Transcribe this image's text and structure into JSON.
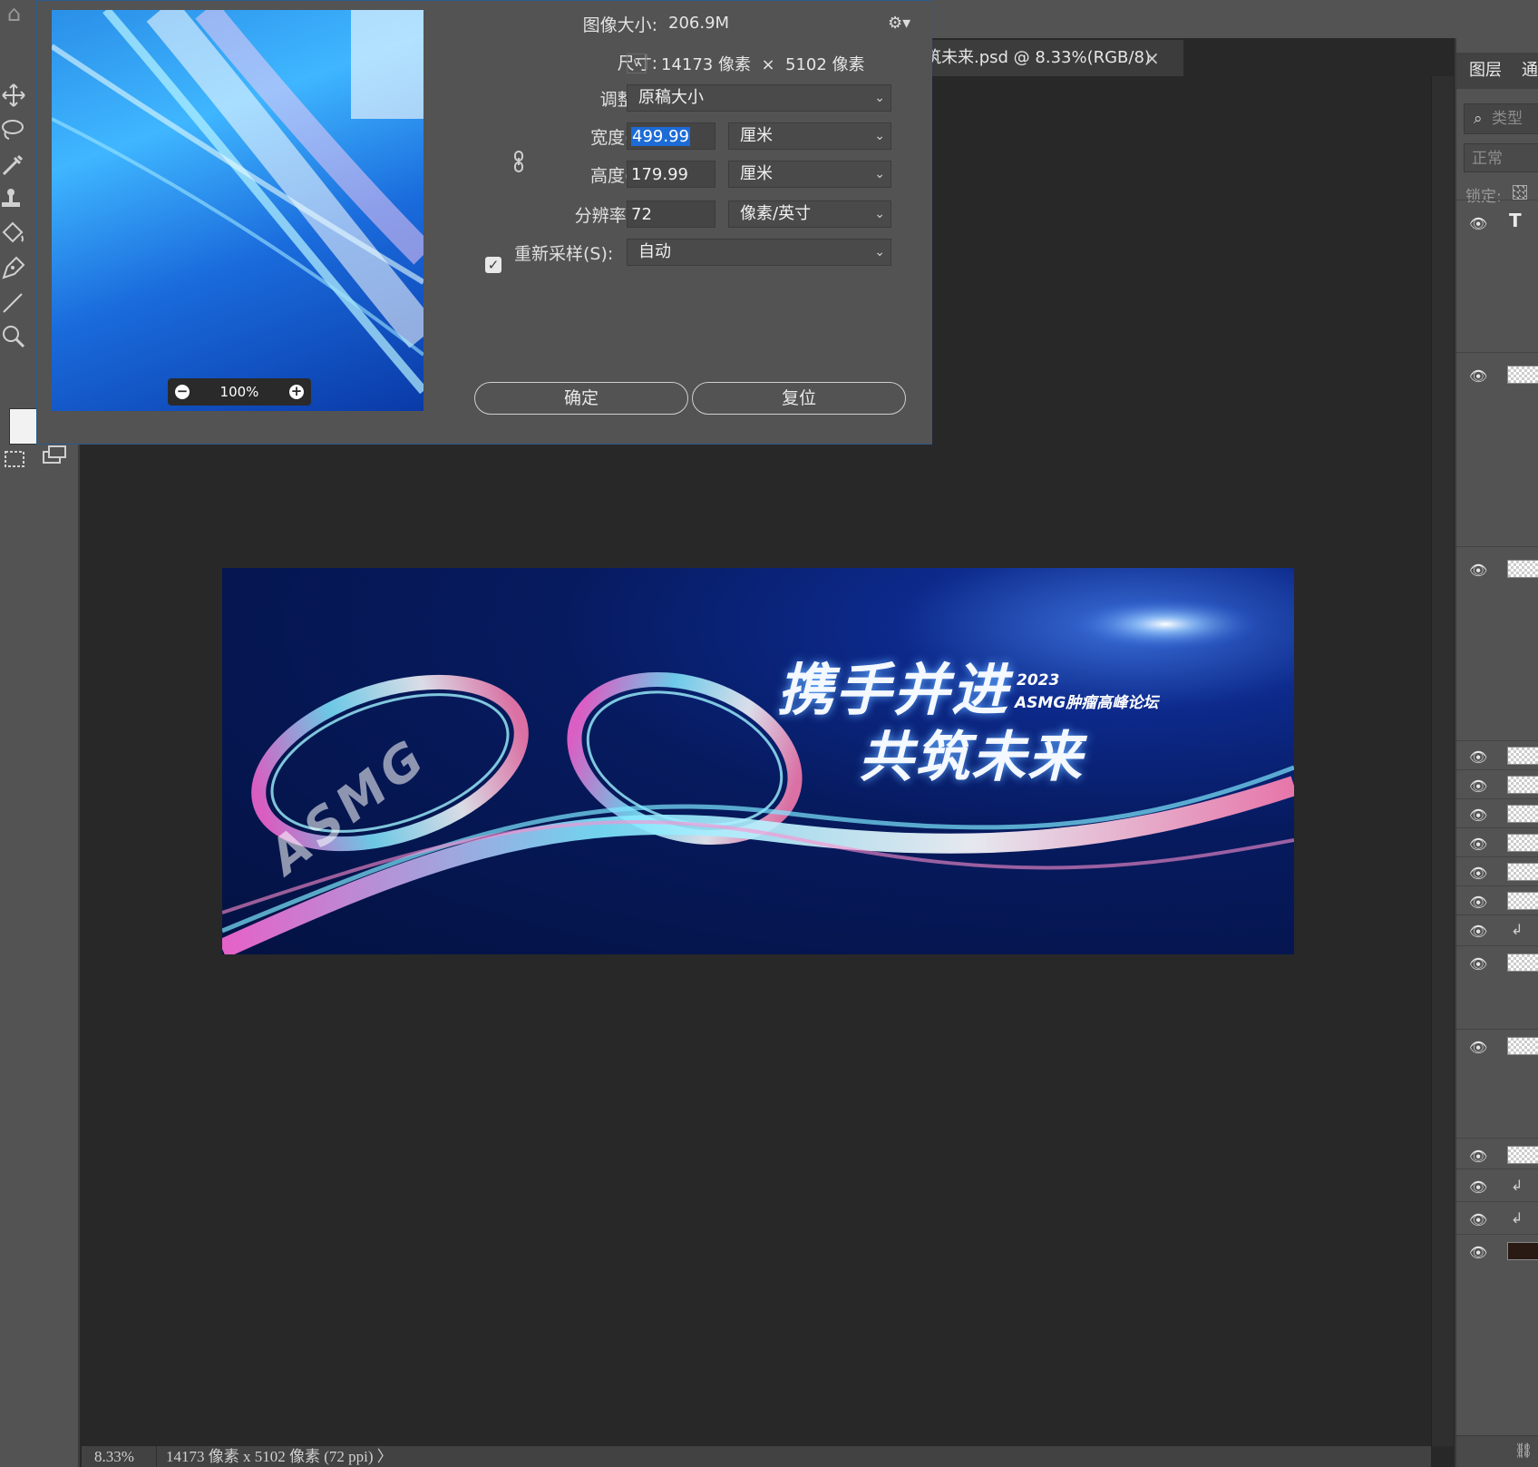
{
  "app": {
    "document_tab": "筑未来.psd @ 8.33%(RGB/8)",
    "tab_close": "×"
  },
  "dialog": {
    "image_size_label": "图像大小:",
    "image_size_value": "206.9M",
    "dimensions_label": "尺寸:",
    "dimensions_width": "14173",
    "dimensions_unit1": "像素",
    "dimensions_times": "×",
    "dimensions_height": "5102",
    "dimensions_unit2": "像素",
    "fit_to_label": "调整为:",
    "fit_to_value": "原稿大小",
    "width_label": "宽度(D):",
    "width_value": "499.99",
    "width_unit": "厘米",
    "height_label": "高度(G):",
    "height_value": "179.99",
    "height_unit": "厘米",
    "resolution_label": "分辨率(R):",
    "resolution_value": "72",
    "resolution_unit": "像素/英寸",
    "resample_label": "重新采样(S):",
    "resample_checked": true,
    "resample_value": "自动",
    "ok_button": "确定",
    "reset_button": "复位",
    "preview_zoom": "100%"
  },
  "artwork": {
    "title_line1": "携手并进",
    "title_line2": "共筑未来",
    "year": "2023",
    "forum": "ASMG肿瘤高峰论坛",
    "logo_text": "ASMG"
  },
  "status": {
    "zoom": "8.33%",
    "dimensions": "14173 像素 x 5102 像素 (72 ppi)",
    "arrow": "〉"
  },
  "layers_panel": {
    "tab_layers": "图层",
    "tab_channels": "通",
    "search_placeholder": "类型",
    "blend_mode": "正常",
    "lock_label": "锁定:",
    "type_layer_glyph": "T"
  },
  "colors": {
    "ui_bg": "#535353",
    "canvas_bg": "#282828",
    "selection": "#1c6bd6",
    "dialog_border": "#2b5b8c"
  },
  "icons": {
    "home": "home-icon",
    "gear": "gear-icon",
    "chain": "chain-link-icon",
    "eye": "eye-icon",
    "search": "search-icon"
  }
}
